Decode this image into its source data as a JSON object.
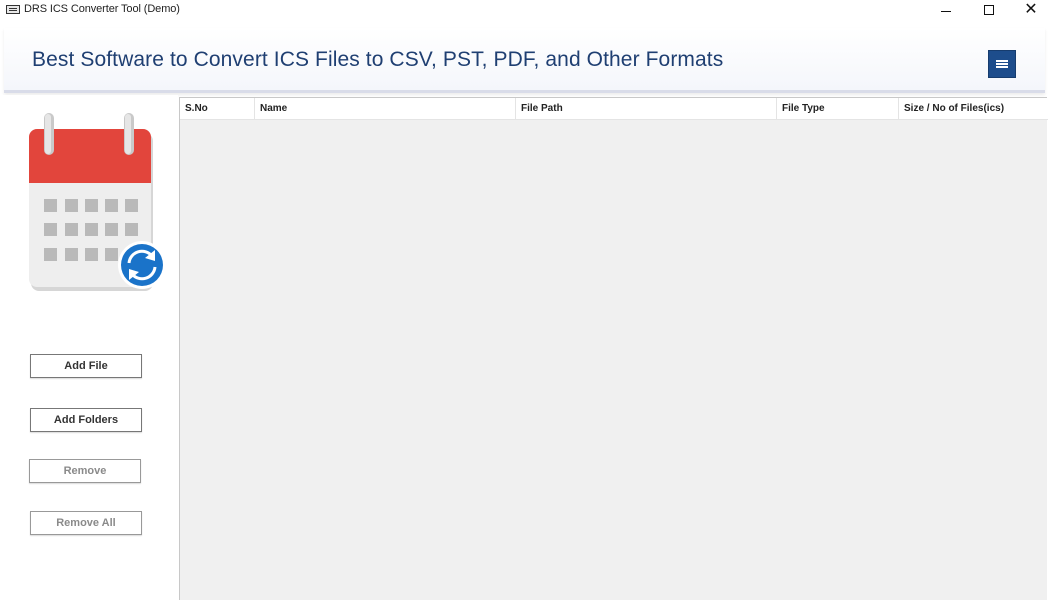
{
  "window": {
    "title": "DRS ICS Converter Tool (Demo)",
    "close_glyph": "✕"
  },
  "banner": {
    "title": "Best Software to Convert ICS Files to CSV, PST, PDF, and Other Formats",
    "menu_icon": "hamburger-menu-icon"
  },
  "sidebar": {
    "logo_icon": "calendar-sync-icon",
    "buttons": {
      "add_file": "Add File",
      "add_folders": "Add Folders",
      "remove": "Remove",
      "remove_all": "Remove All"
    }
  },
  "table": {
    "columns": [
      "S.No",
      "Name",
      "File Path",
      "File Type",
      "Size / No of Files(ics)"
    ],
    "rows": []
  },
  "colors": {
    "banner_title": "#1f3f72",
    "menu_button": "#1d4d8c",
    "calendar_header": "#e2453c",
    "sync_badge": "#1a73c9",
    "table_background": "#f0f0f0"
  }
}
